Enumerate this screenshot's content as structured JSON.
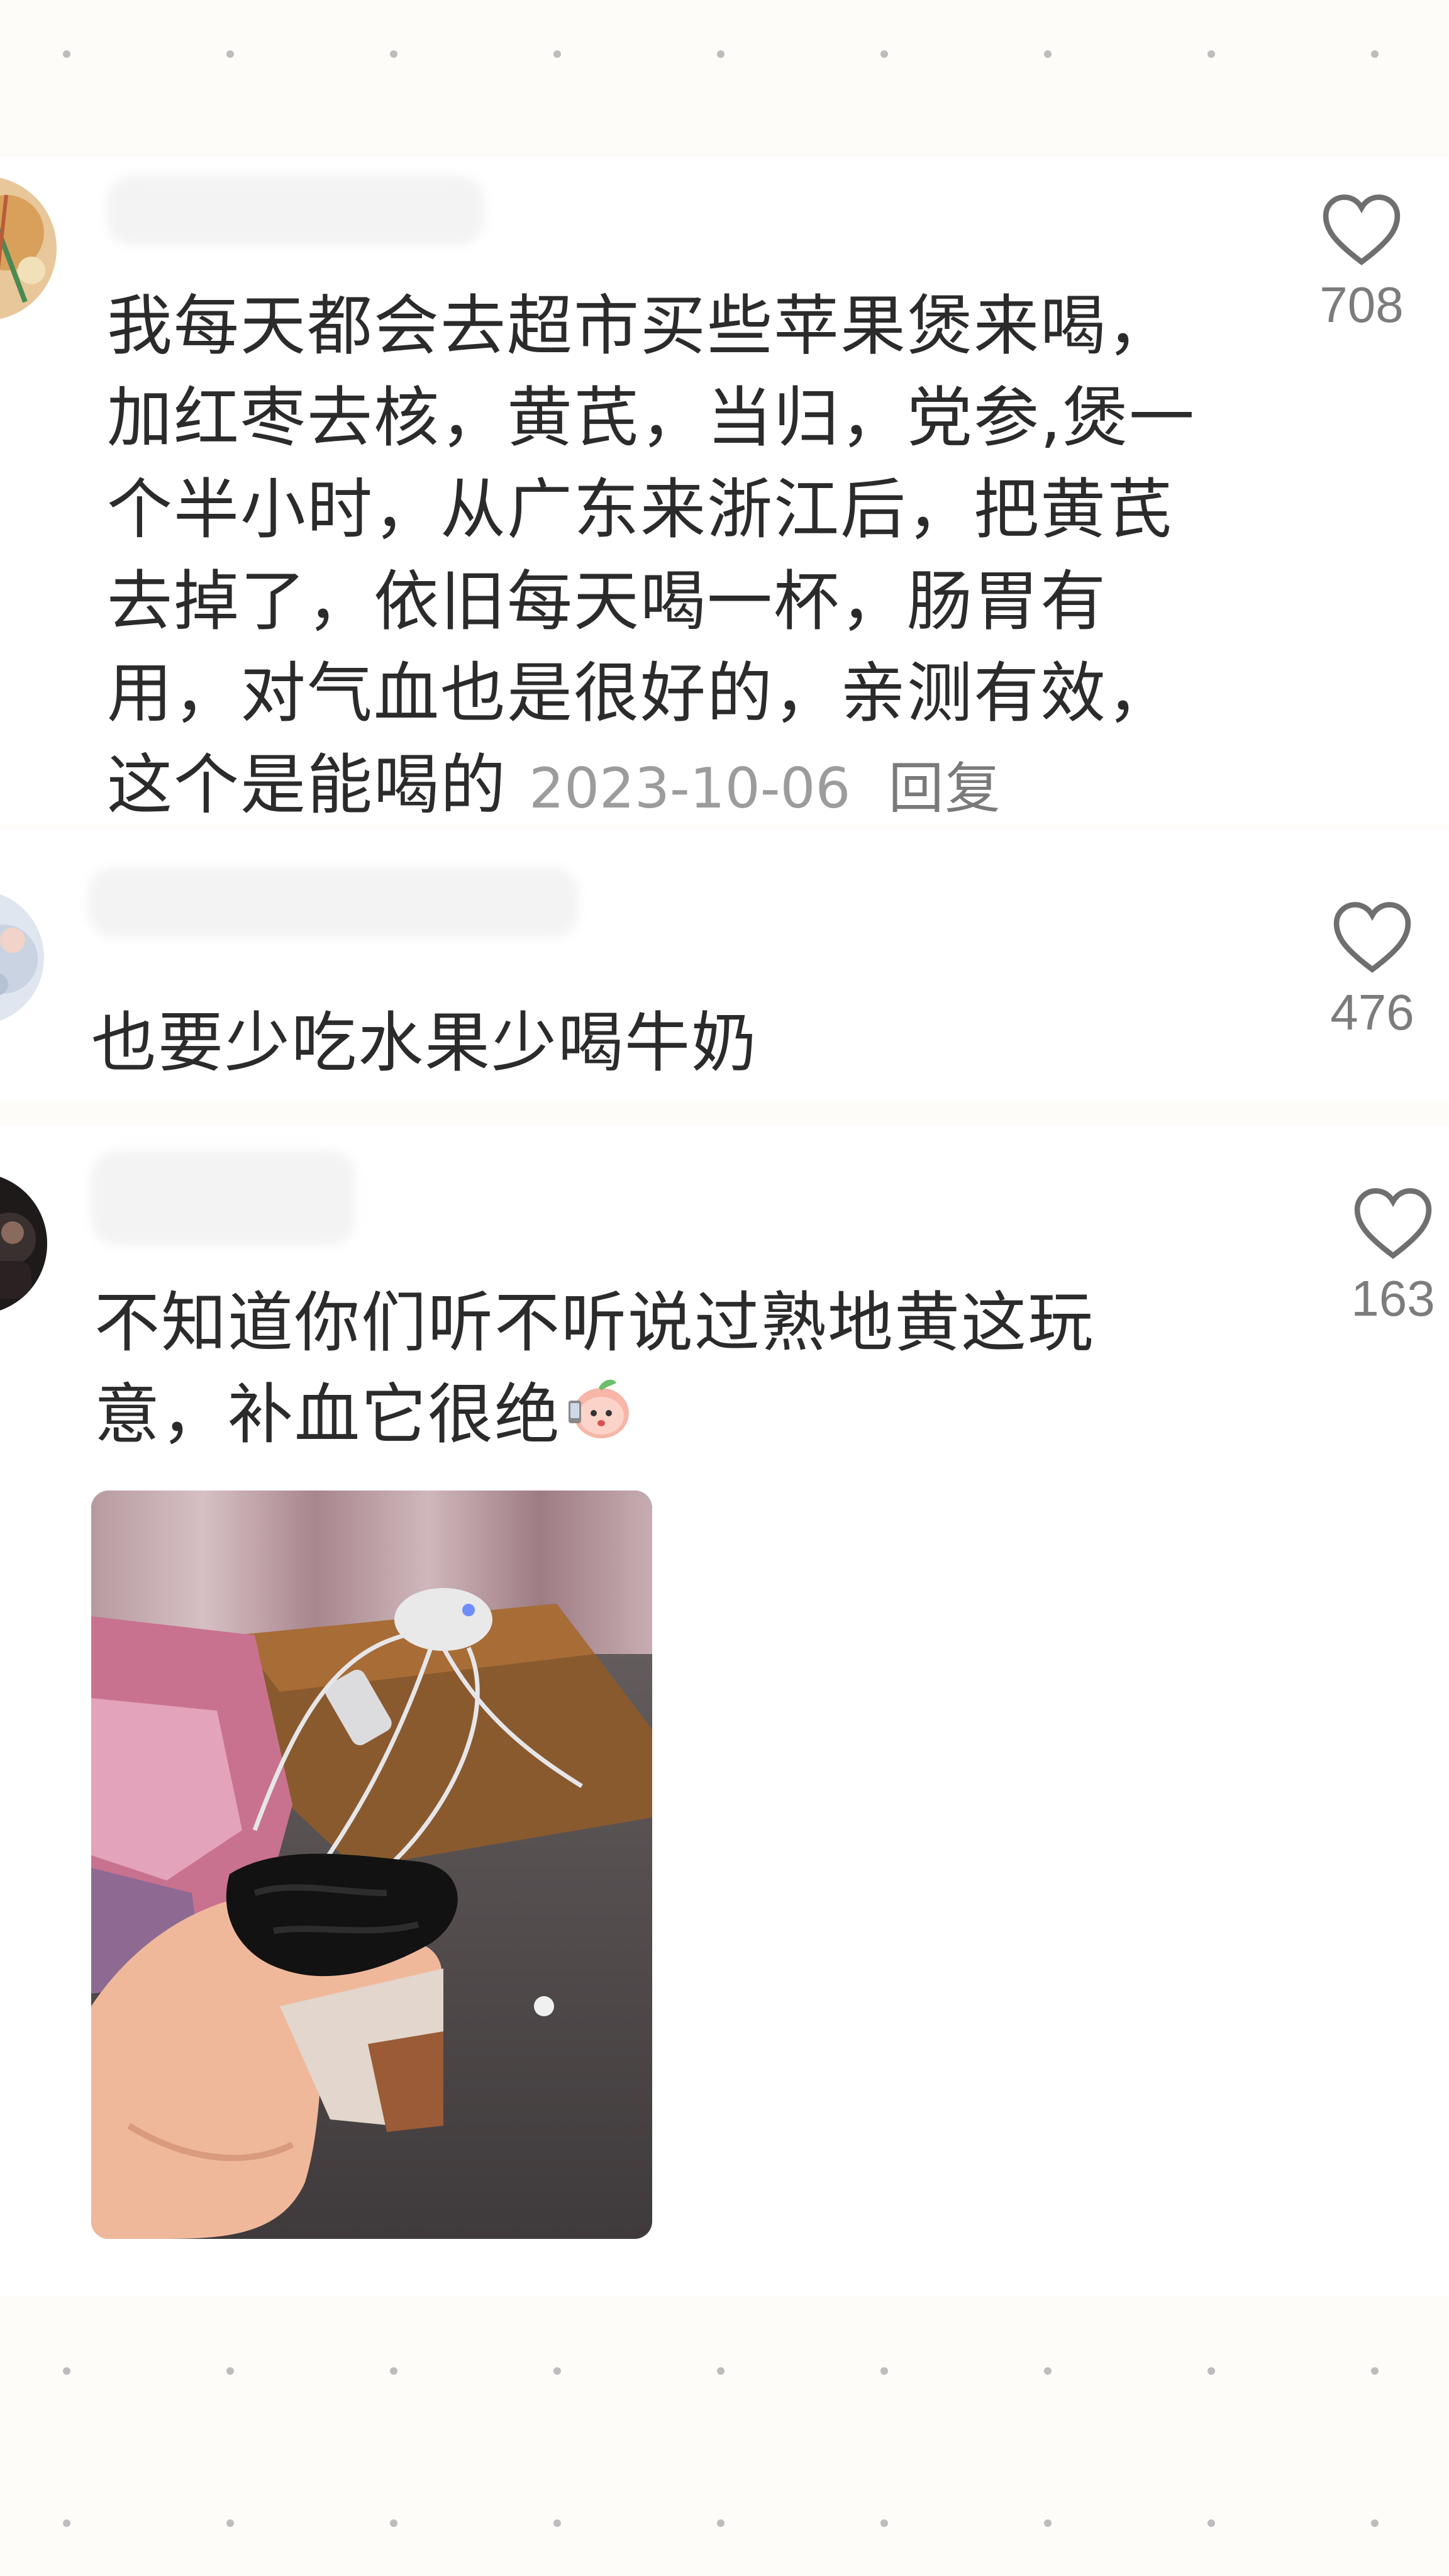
{
  "comments": [
    {
      "text": "我每天都会去超市买些苹果煲来喝，\n加红枣去核，黄芪，当归，党参,煲一\n个半小时，从广东来浙江后，把黄芪\n去掉了，依旧每天喝一杯，肠胃有\n用，对气血也是很好的，亲测有效，\n这个是能喝的",
      "date": "2023-10-06",
      "reply_label": "回复",
      "likes": "708"
    },
    {
      "text": "也要少吃水果少喝牛奶",
      "likes": "476"
    },
    {
      "text": "不知道你们听不听说过熟地黄这玩\n意，补血它很绝",
      "likes": "163",
      "emoji_icon": "peach-face-emoji"
    }
  ],
  "colors": {
    "background": "#fdfcf8",
    "text": "#2b2b2b",
    "meta": "#9c9c9c",
    "icon": "#6f6f6f"
  }
}
